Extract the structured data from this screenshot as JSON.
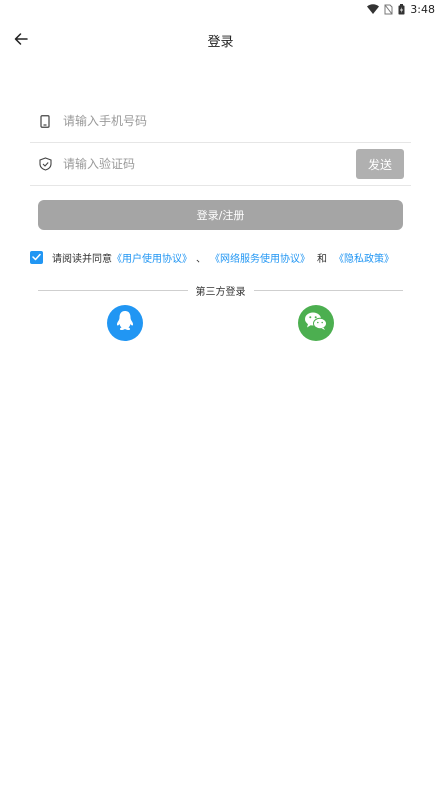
{
  "status_bar": {
    "time": "3:48",
    "icons": [
      "wifi-icon",
      "no-sim-icon",
      "battery-icon"
    ]
  },
  "header": {
    "title": "登录",
    "back_icon": "arrow-left-icon"
  },
  "form": {
    "phone_placeholder": "请输入手机号码",
    "phone_value": "",
    "phone_icon": "phone-icon",
    "code_placeholder": "请输入验证码",
    "code_value": "",
    "code_icon": "shield-check-icon",
    "send_label": "发送",
    "login_label": "登录/注册"
  },
  "agreement": {
    "checked": true,
    "prefix": "请阅读并同意",
    "user_agreement": "《用户使用协议》",
    "separator": "、",
    "network_agreement": "《网络服务使用协议》",
    "and": "和",
    "privacy_policy": "《隐私政策》"
  },
  "third_party": {
    "label": "第三方登录",
    "qq_icon": "qq-icon",
    "wechat_icon": "wechat-icon"
  },
  "colors": {
    "accent": "#2196f3",
    "wechat": "#4caf50",
    "disabled_button": "#a5a5a5",
    "send_button": "#b0b0b0"
  }
}
